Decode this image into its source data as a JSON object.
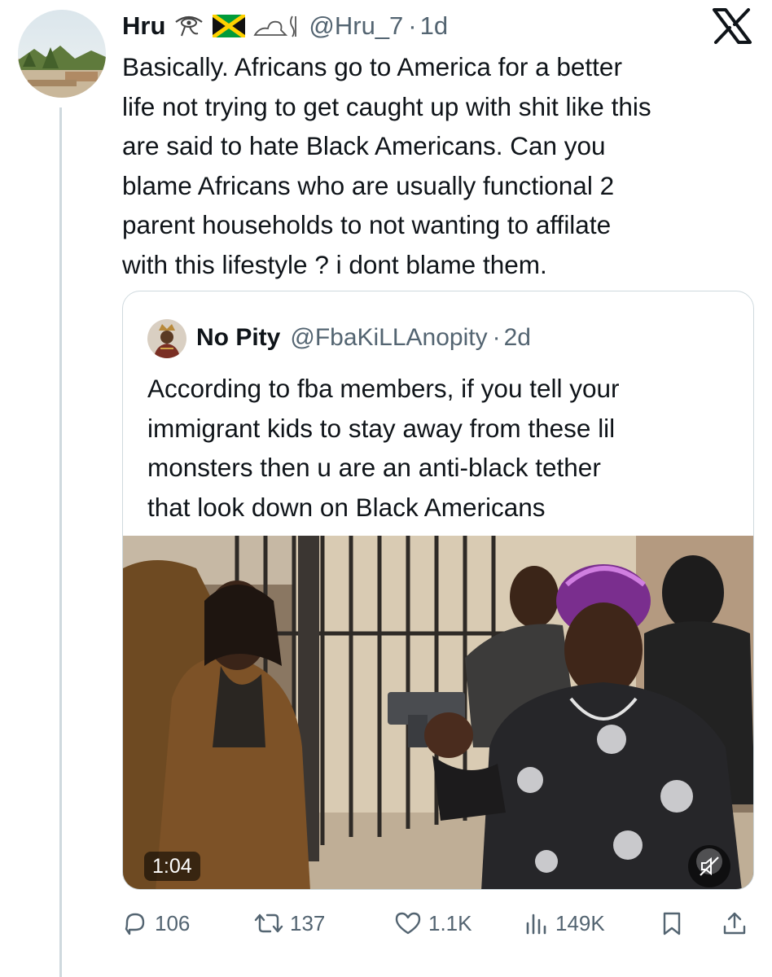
{
  "author": {
    "name": "Hru",
    "handle": "@Hru_7",
    "separator": "·",
    "time": "1d",
    "badge_icons": [
      "eye-of-horus-icon",
      "jamaica-flag-icon",
      "lion-hieroglyph-icon"
    ]
  },
  "tweet": {
    "text": "Basically.  Africans go to America for a better\nlife not trying to get caught up with shit like this\nare said to hate Black Americans. Can you\nblame Africans who are usually functional 2\nparent households to not wanting to affilate\nwith this lifestyle ? i dont blame them."
  },
  "quoted": {
    "name": "No Pity",
    "handle": "@FbaKiLLAnopity",
    "separator": "·",
    "time": "2d",
    "text": "According to fba members, if you tell your\nimmigrant kids to stay away from these lil\nmonsters then u are an anti-black tether\nthat look down on Black Americans",
    "video": {
      "duration": "1:04",
      "muted": true
    }
  },
  "actions": {
    "replies": "106",
    "reposts": "137",
    "likes": "1.1K",
    "views": "149K"
  },
  "colors": {
    "text": "#0f1419",
    "secondary": "#536471",
    "border": "#cfd9de",
    "thread_line": "#cfd9de"
  },
  "icons": [
    "x-logo-icon",
    "reply-icon",
    "repost-icon",
    "like-icon",
    "views-icon",
    "bookmark-icon",
    "share-icon",
    "mute-icon"
  ]
}
